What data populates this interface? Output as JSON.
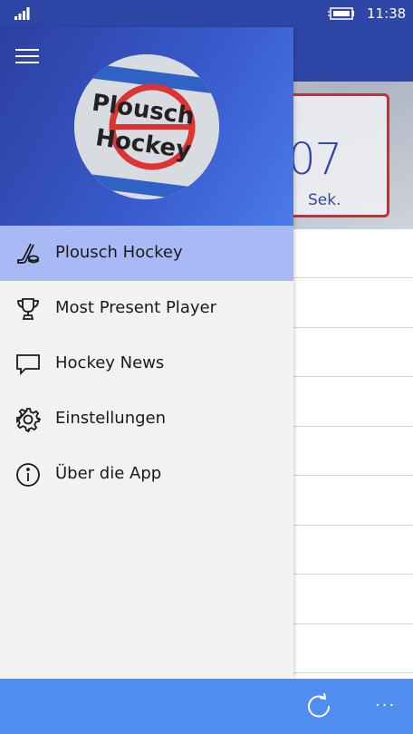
{
  "status_bar": {
    "time": "11:38"
  },
  "background_content": {
    "seconds_value": "07",
    "seconds_unit": "Sek."
  },
  "nav": {
    "logo_text_line1": "Plousch",
    "logo_text_line2": "Hockey",
    "items": [
      {
        "label": "Plousch Hockey",
        "icon": "hockey-stick-puck-icon",
        "selected": true
      },
      {
        "label": "Most Present Player",
        "icon": "trophy-icon",
        "selected": false
      },
      {
        "label": "Hockey News",
        "icon": "chat-bubble-icon",
        "selected": false
      },
      {
        "label": "Einstellungen",
        "icon": "gear-icon",
        "selected": false
      },
      {
        "label": "Über die App",
        "icon": "info-icon",
        "selected": false
      }
    ]
  },
  "command_bar": {
    "more_label": "···"
  },
  "colors": {
    "accent_dark": "#2e47a6",
    "selected_item": "#a9b9f5",
    "command_bar": "#4f8df1",
    "timer_border": "#d52a2a"
  }
}
